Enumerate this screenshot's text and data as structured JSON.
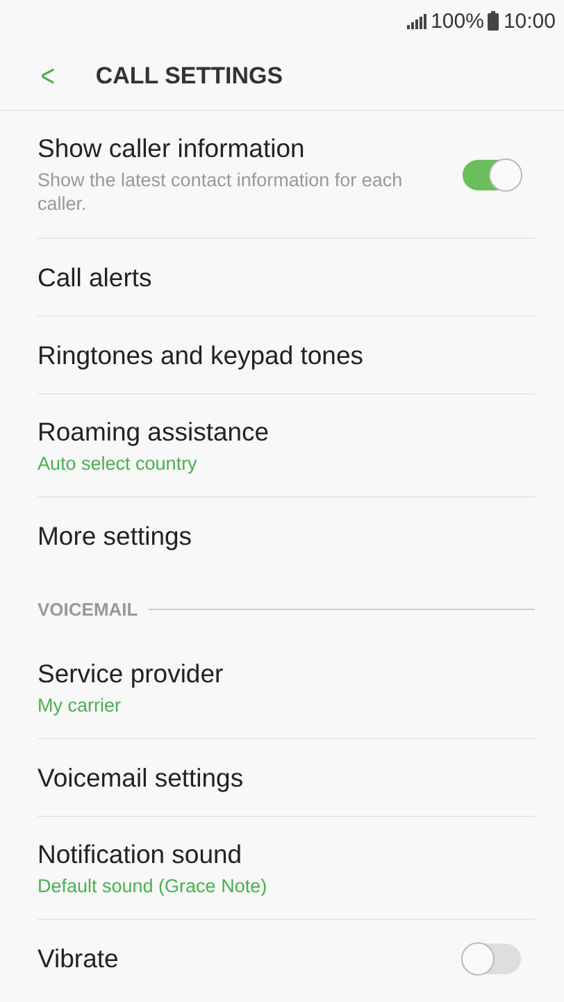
{
  "status_bar": {
    "battery": "100%",
    "time": "10:00"
  },
  "header": {
    "back": "<",
    "title": "CALL SETTINGS"
  },
  "items": [
    {
      "kind": "setting",
      "title": "Show caller information",
      "description": "Show the latest contact information for each caller.",
      "toggle": {
        "on": true
      }
    },
    {
      "kind": "setting",
      "title": "Call alerts"
    },
    {
      "kind": "setting",
      "title": "Ringtones and keypad tones"
    },
    {
      "kind": "setting",
      "title": "Roaming assistance",
      "value": "Auto select country"
    },
    {
      "kind": "setting",
      "title": "More settings"
    },
    {
      "kind": "header",
      "title": "VOICEMAIL"
    },
    {
      "kind": "setting",
      "title": "Service provider",
      "value": "My carrier"
    },
    {
      "kind": "setting",
      "title": "Voicemail settings"
    },
    {
      "kind": "setting",
      "title": "Notification sound",
      "value": "Default sound (Grace Note)"
    },
    {
      "kind": "setting",
      "title": "Vibrate",
      "toggle": {
        "on": false
      }
    }
  ]
}
